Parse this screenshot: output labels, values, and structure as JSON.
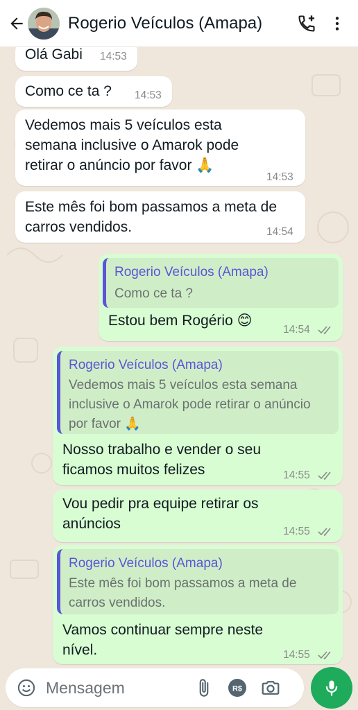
{
  "header": {
    "contact_name": "Rogerio Veículos (Amapa)"
  },
  "messages": [
    {
      "direction": "incoming",
      "text": "Olá Gabi",
      "time": "14:53"
    },
    {
      "direction": "incoming",
      "text": "Como ce ta ?",
      "time": "14:53"
    },
    {
      "direction": "incoming",
      "text": "Vedemos mais 5 veículos esta semana inclusive o Amarok pode retirar o anúncio por favor 🙏",
      "time": "14:53"
    },
    {
      "direction": "incoming",
      "text": "Este mês foi bom passamos a meta de carros vendidos.",
      "time": "14:54"
    },
    {
      "direction": "outgoing",
      "quote_author": "Rogerio Veículos (Amapa)",
      "quote_text": "Como ce ta ?",
      "text": "Estou bem Rogério 😊",
      "time": "14:54"
    },
    {
      "direction": "outgoing",
      "quote_author": "Rogerio Veículos (Amapa)",
      "quote_text": "Vedemos mais 5 veículos esta semana inclusive o Amarok pode retirar o anúncio por favor 🙏",
      "text": "Nosso trabalho e vender o seu ficamos muitos felizes",
      "time": "14:55"
    },
    {
      "direction": "outgoing",
      "text": "Vou pedir pra equipe retirar os anúncios",
      "time": "14:55"
    },
    {
      "direction": "outgoing",
      "quote_author": "Rogerio Veículos (Amapa)",
      "quote_text": "Este mês foi bom passamos a meta de carros vendidos.",
      "text": "Vamos continuar sempre neste nível.",
      "time": "14:55"
    }
  ],
  "composer": {
    "placeholder": "Mensagem",
    "currency_label": "R$"
  },
  "colors": {
    "chat_bg": "#efe7dc",
    "incoming_bubble": "#ffffff",
    "outgoing_bubble": "#d8fdd2",
    "quote_accent": "#5b54d9",
    "read_ticks": "#8a8a8a",
    "mic_button": "#1eab5b"
  },
  "icons": [
    "back-arrow-icon",
    "add-call-icon",
    "more-vert-icon",
    "emoji-icon",
    "attach-icon",
    "currency-icon",
    "camera-icon",
    "mic-icon",
    "double-check-icon"
  ]
}
